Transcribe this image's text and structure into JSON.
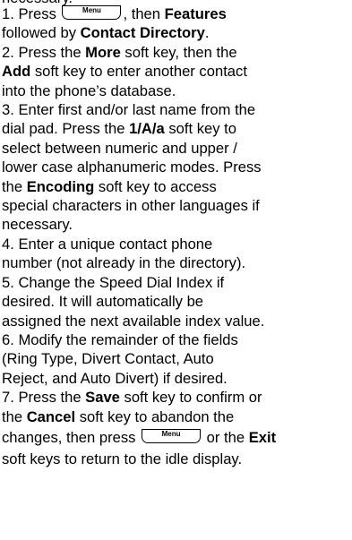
{
  "top_partial": "necessary.",
  "menu_key_label": "Menu",
  "steps": {
    "s1": {
      "a": "1. Press ",
      "b": ", then ",
      "c": "Features",
      "d": "followed by ",
      "e": "Contact Directory",
      "f": "."
    },
    "s2": {
      "a": "2. Press the ",
      "b": "More",
      "c": " soft key, then the",
      "d": "Add",
      "e": " soft key to enter another contact",
      "f": "into the phone’s database."
    },
    "s3": {
      "a": "3. Enter first and/or last name from the",
      "b": "dial pad. Press the ",
      "c": "1/A/a",
      "d": " soft key to",
      "e": "select between numeric and upper /",
      "f": "lower case alphanumeric modes. Press",
      "g": "the ",
      "h": "Encoding",
      "i": " soft key to access",
      "j": "special characters in other languages if",
      "k": "necessary."
    },
    "s4": {
      "a": "4. Enter a unique contact phone",
      "b": "number (not already in the directory)."
    },
    "s5": {
      "a": "5. Change the Speed Dial Index if",
      "b": "desired. It will automatically be",
      "c": "assigned the next available index value."
    },
    "s6": {
      "a": "6. Modify the remainder of the fields",
      "b": "(Ring Type, Divert Contact, Auto",
      "c": "Reject, and Auto Divert) if desired."
    },
    "s7": {
      "a": "7. Press the ",
      "b": "Save",
      "c": " soft key to confirm or",
      "d": "the ",
      "e": "Cancel",
      "f": " soft key to abandon the",
      "g": "changes, then press ",
      "h": " or the ",
      "i": "Exit",
      "j": "soft keys to return to the idle display."
    }
  }
}
